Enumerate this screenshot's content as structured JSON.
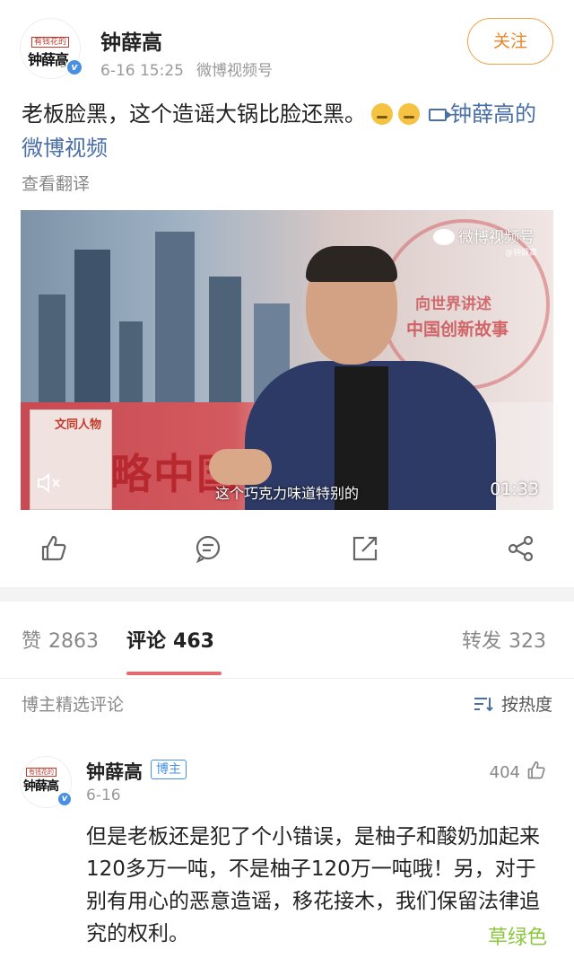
{
  "post": {
    "author": "钟薛高",
    "avatar_text": "钟薛高",
    "avatar_tag": "有钱花的",
    "avatar_sub": "Chica",
    "verified_mark": "v",
    "date": "6-16 15:25",
    "source": "微博视频号",
    "follow_label": "关注",
    "text": "老板脸黑，这个造谣大锅比脸还黑。",
    "video_link_text": "钟薛高的微博视频",
    "translate_label": "查看翻译"
  },
  "video": {
    "subtitle": "这个巧克力味道特别的",
    "duration": "01:33",
    "watermark": "微博视频号",
    "watermark_sub": "@钟薛高",
    "banner_text": "略中国论",
    "logo_line1": "向世界讲述",
    "logo_line2": "中国创新故事",
    "poster_title": "文同人物"
  },
  "actions": [
    "like-icon",
    "comment-icon",
    "repost-icon",
    "share-icon"
  ],
  "tabs": {
    "likes_label": "赞",
    "likes_count": "2863",
    "comments_label": "评论",
    "comments_count": "463",
    "reposts_label": "转发",
    "reposts_count": "323"
  },
  "comments_section": {
    "curated_label": "博主精选评论",
    "sort_label": "按热度"
  },
  "comment": {
    "author": "钟薛高",
    "badge": "博主",
    "date": "6-16",
    "likes": "404",
    "text": "但是老板还是犯了个小错误，是柚子和酸奶加起来120多万一吨，不是柚子120万一吨哦！另，对于别有用心的恶意造谣，移花接木，我们保留法律追究的权利。"
  },
  "watermark_text": "草绿色",
  "colors": {
    "follow": "#e8852a",
    "link": "#4a6fa5",
    "tab_underline": "#e36a6f",
    "badge": "#4a90e2",
    "watermark": "#8dc63f"
  }
}
